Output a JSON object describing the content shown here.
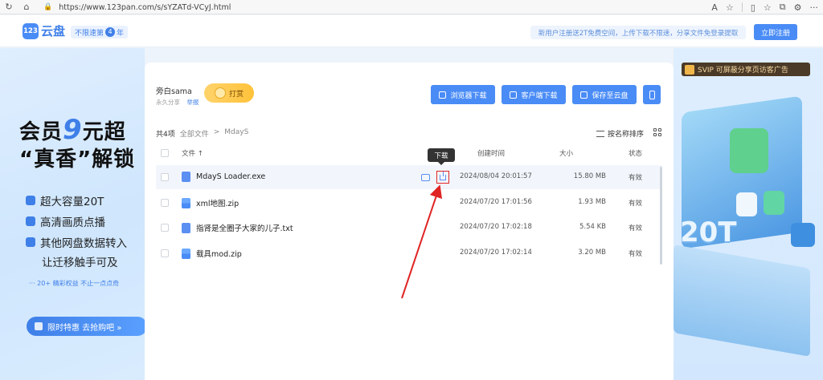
{
  "browser": {
    "url": "https://www.123pan.com/s/sYZATd-VCyJ.html"
  },
  "header": {
    "logo_badge": "123",
    "logo_text": "云盘",
    "tagline_pre": "不限速第",
    "tagline_num": "4",
    "tagline_post": "年",
    "promo": "新用户注册送2T免费空间，上传下载不限速，分享文件免登录提取",
    "login_label": "立即注册"
  },
  "left_promo": {
    "line1_pre": "会员",
    "line1_num": "9",
    "line1_post": "元超",
    "line2": "“真香”解锁",
    "features": [
      "超大容量20T",
      "高清画质点播",
      "其他网盘数据转入"
    ],
    "feature_sub": "让迁移触手可及",
    "note": "···  20+ 精彩权益   不止一点点奇",
    "deal_label": "限时特惠  去抢购吧  »"
  },
  "right_promo": {
    "svip_text": "SVIP 可屏蔽分享页访客广告",
    "big_text": "20T"
  },
  "sharer": {
    "name": "旁白sama",
    "meta": "永久分享",
    "report": "举报",
    "reward_label": "打赏"
  },
  "actions": {
    "browser_download": "浏览器下载",
    "client_download": "客户端下载",
    "save_to_cloud": "保存至云盘"
  },
  "listing": {
    "count": "共4项",
    "crumb_root": "全部文件",
    "crumb_sep": ">",
    "crumb_current": "MdayS",
    "sort_label": "按名称排序",
    "columns": {
      "name": "文件 ↑",
      "created": "创建时间",
      "size": "大小",
      "status": "状态"
    },
    "tooltip": "下载",
    "files": [
      {
        "name": "MdayS Loader.exe",
        "type": "exe",
        "created": "2024/08/04 20:01:57",
        "size": "15.80 MB",
        "status": "有效"
      },
      {
        "name": "xml地图.zip",
        "type": "zip",
        "created": "2024/07/20 17:01:56",
        "size": "1.93 MB",
        "status": "有效"
      },
      {
        "name": "指肾是全圈子大家的儿子.txt",
        "type": "txt",
        "created": "2024/07/20 17:02:18",
        "size": "5.54 KB",
        "status": "有效"
      },
      {
        "name": "载具mod.zip",
        "type": "zip",
        "created": "2024/07/20 17:02:14",
        "size": "3.20 MB",
        "status": "有效"
      }
    ]
  },
  "colors": {
    "accent": "#4a8cf6",
    "highlight": "#e02424"
  }
}
